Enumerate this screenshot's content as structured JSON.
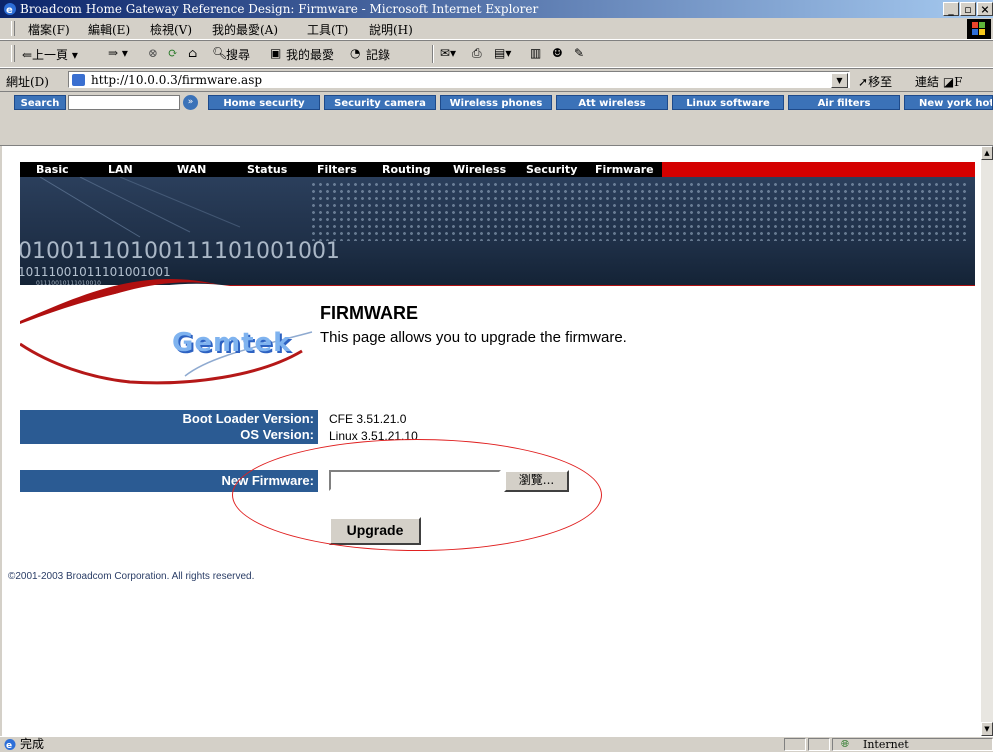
{
  "window": {
    "title": "Broadcom Home Gateway Reference Design: Firmware - Microsoft Internet Explorer",
    "controls": [
      "_",
      "ǀ",
      "×"
    ]
  },
  "menu": [
    "檔案(F)",
    "編輯(E)",
    "檢視(V)",
    "我的最愛(A)",
    "工具(T)",
    "說明(H)"
  ],
  "toolbar": {
    "back": "⇐上一頁 ▾",
    "forward": "⇒ ▾",
    "search": "搜尋",
    "favorites": "我的最愛",
    "history": "記錄"
  },
  "address": {
    "label": "網址(D)",
    "url": "http://10.0.0.3/firmware.asp",
    "go": "移至",
    "links": "連結"
  },
  "searchbar": {
    "search_label": "Search",
    "go_glyph": "»",
    "links": [
      "Home security",
      "Security camera",
      "Wireless phones",
      "Att wireless",
      "Linux software",
      "Air filters",
      "New york hot"
    ]
  },
  "nav": [
    "Basic",
    "LAN",
    "WAN",
    "Status",
    "Filters",
    "Routing",
    "Wireless",
    "Security",
    "Firmware"
  ],
  "banner": {
    "binary1": "01001110100111101001001",
    "binary2": "10111001011101001001",
    "binary3": "01110010111010010",
    "logo": "Gemtek"
  },
  "page": {
    "title": "FIRMWARE",
    "description": "This page allows you to upgrade the firmware.",
    "boot_loader_label": "Boot Loader Version:",
    "boot_loader_value": "CFE 3.51.21.0",
    "os_label": "OS Version:",
    "os_value": "Linux 3.51.21.10",
    "new_firmware_label": "New Firmware:",
    "browse_label": "瀏覽...",
    "upgrade_label": "Upgrade",
    "copyright": "©2001-2003 Broadcom Corporation. All rights reserved."
  },
  "status": {
    "text": "完成",
    "zone": "Internet"
  }
}
